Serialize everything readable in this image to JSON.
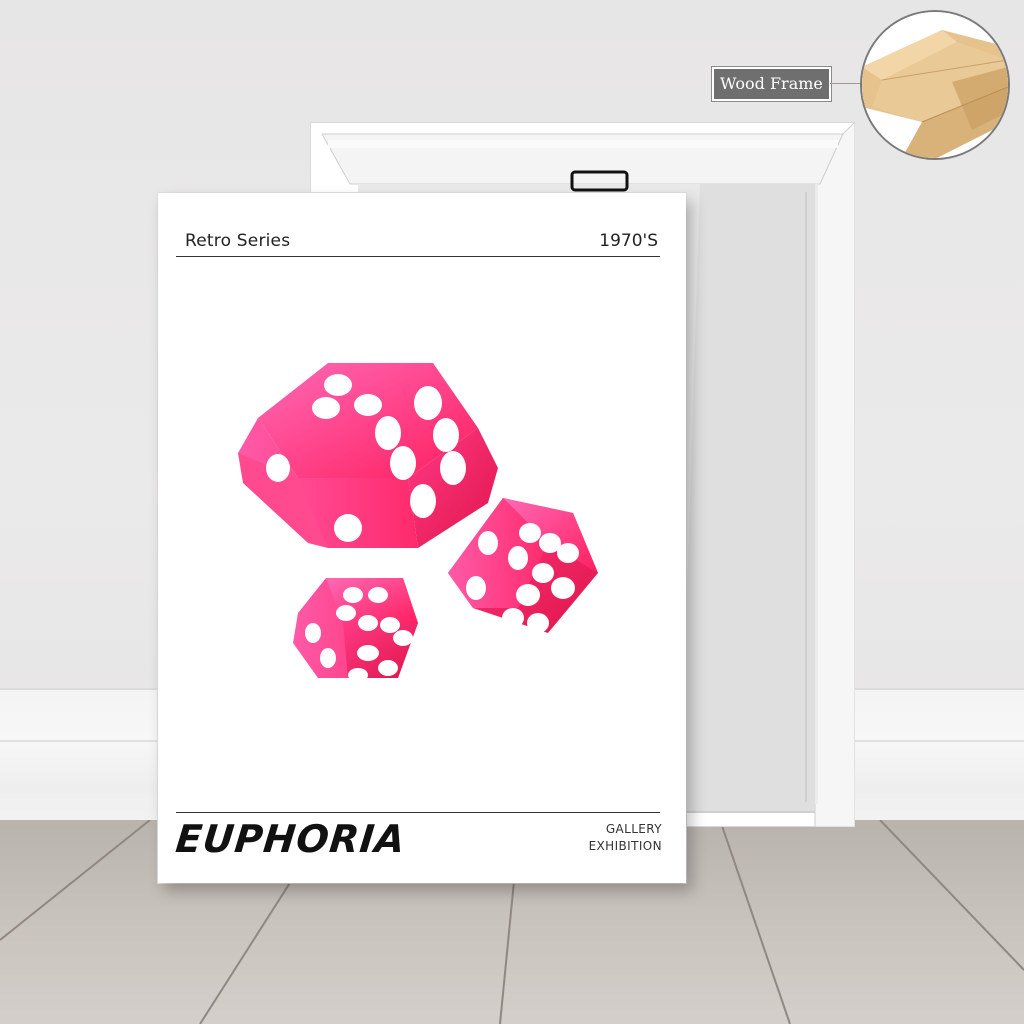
{
  "callout": {
    "label": "Wood Frame"
  },
  "poster": {
    "series": "Retro Series",
    "year": "1970'S",
    "title": "EUPHORIA",
    "gallery_line1": "GALLERY",
    "gallery_line2": "EXHIBITION"
  },
  "colors": {
    "dice": "#ff2f7a",
    "pips": "#ffffff",
    "wood": "#e8c48f"
  }
}
